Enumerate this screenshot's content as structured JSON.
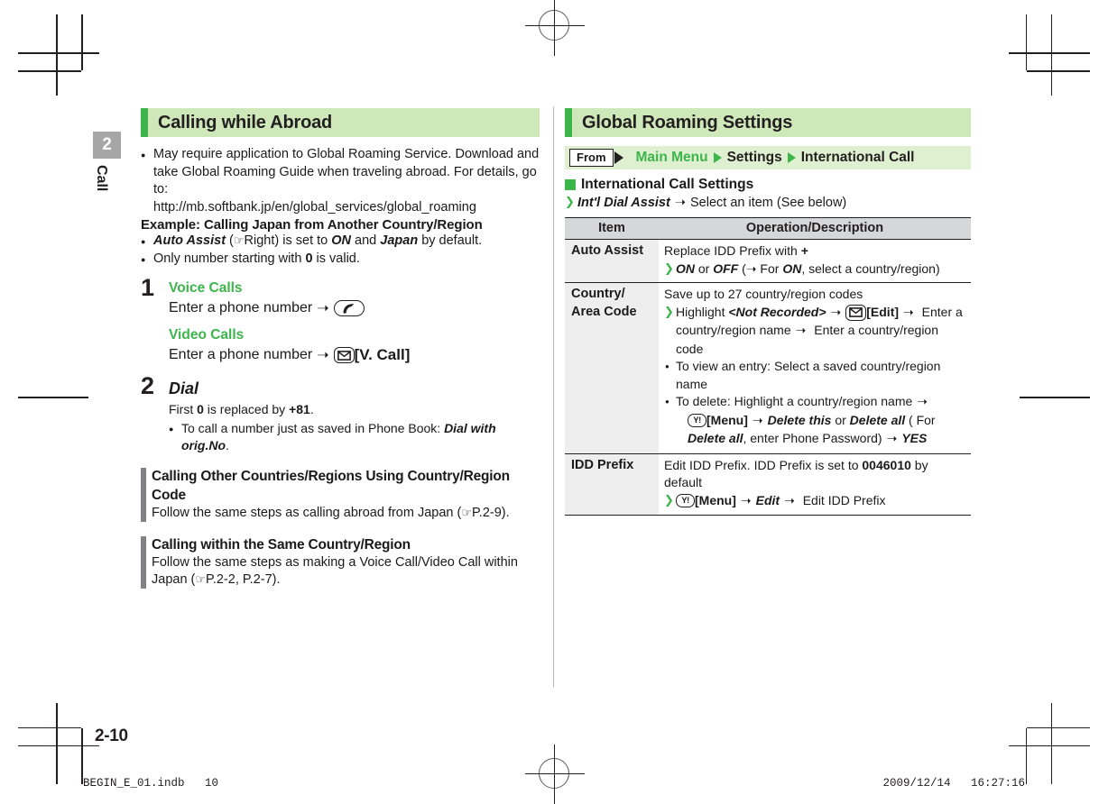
{
  "chapter": {
    "number": "2",
    "label": "Call"
  },
  "page_number": "2-10",
  "left_column": {
    "heading": "Calling while Abroad",
    "intro_bullet": "May require application to Global Roaming Service. Download and take Global Roaming Guide when traveling abroad. For details, go to:",
    "intro_url": "http://mb.softbank.jp/en/global_services/global_roaming",
    "example_heading": "Example: Calling Japan from Another Country/Region",
    "bullet_auto_assist": {
      "term": "Auto Assist",
      "ref": "Right",
      "mid": ") is set to ",
      "value_on": "ON",
      "and": " and ",
      "value_japan": "Japan",
      "tail": " by default."
    },
    "bullet_zero": {
      "pre": "Only number starting with ",
      "digit": "0",
      "post": " is valid."
    },
    "steps": [
      {
        "number": "1",
        "sub_voice": "Voice Calls",
        "line_voice": "Enter a phone number",
        "key_voice": "call-key-icon",
        "sub_video": "Video Calls",
        "line_video": "Enter a phone number",
        "key_video": "mail-key-icon",
        "video_label": "[V. Call]"
      },
      {
        "number": "2",
        "title": "Dial",
        "note_pre": "First ",
        "note_zero": "0",
        "note_mid": " is replaced by ",
        "note_plus": "+81",
        "note_post": ".",
        "bullet_pre": "To call a number just as saved in Phone Book: ",
        "bullet_term": "Dial with orig.No",
        "bullet_post": "."
      }
    ],
    "sub_sections": [
      {
        "heading": "Calling Other Countries/Regions Using Country/Region Code",
        "body_pre": "Follow the same steps as calling abroad from Japan (",
        "body_ref": "P.2-9",
        "body_post": ")."
      },
      {
        "heading": "Calling within the Same Country/Region",
        "body_pre": "Follow the same steps as making a Voice Call/Video Call within Japan (",
        "body_ref": "P.2-2, P.2-7",
        "body_post": ")."
      }
    ]
  },
  "right_column": {
    "heading": "Global Roaming Settings",
    "breadcrumb": {
      "from_label": "From",
      "item_1": "Main Menu",
      "item_2": "Settings",
      "item_3": "International Call"
    },
    "section_heading": "International Call Settings",
    "section_step": {
      "term": "Int'l Dial Assist",
      "rest": "Select an item (See below)"
    },
    "table": {
      "headers": [
        "Item",
        "Operation/Description"
      ],
      "rows": [
        {
          "item": "Auto Assist",
          "desc_line1_pre": "Replace IDD Prefix with ",
          "desc_line1_bold": "+",
          "desc_line2": {
            "on": "ON",
            "or": " or ",
            "off": "OFF",
            "paren_open": " (",
            "arrow_txt": " For ",
            "on2": "ON",
            "tail": ", select a country/region)"
          }
        },
        {
          "item": "Country/ Area Code",
          "desc_line1": "Save up to 27 country/region codes",
          "desc_line2": {
            "highlight": "Highlight ",
            "not_recorded": "<Not Recorded>",
            "edit_label": "[Edit]",
            "tail1": " Enter a country/region name",
            "tail2": " Enter a country/region code"
          },
          "bullet_1": "To view an entry: Select a saved country/region name",
          "bullet_2": {
            "pre": "To delete: Highlight a country/region name",
            "menu_label": "[Menu]",
            "delete_this": "Delete this",
            "or": " or ",
            "delete_all": "Delete all",
            "paren": " ( For ",
            "delete_all_2": "Delete all",
            "tail": ", enter Phone Password)",
            "yes": "YES"
          }
        },
        {
          "item": "IDD Prefix",
          "desc_line1_pre": "Edit IDD Prefix. IDD Prefix is set to ",
          "desc_line1_bold": "0046010",
          "desc_line1_post": " by default",
          "desc_line2": {
            "menu_label": "[Menu]",
            "edit": "Edit",
            "tail": " Edit IDD Prefix"
          }
        }
      ]
    }
  },
  "footer": {
    "file_info": "BEGIN_E_01.indb   10",
    "timestamp": "2009/12/14   16:27:16"
  }
}
